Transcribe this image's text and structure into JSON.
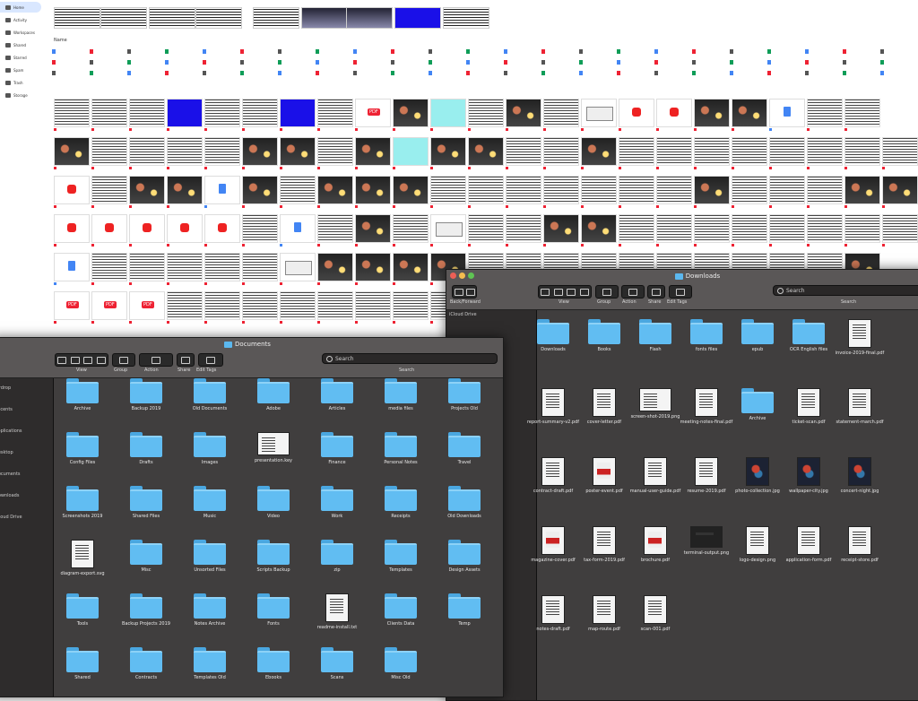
{
  "drive": {
    "sidebar": {
      "items": [
        {
          "label": "Home",
          "icon": "home-icon",
          "active": true
        },
        {
          "label": "Activity",
          "icon": "activity-icon"
        },
        {
          "label": "Workspaces",
          "icon": "workspace-icon"
        },
        {
          "label": "Shared",
          "icon": "shared-icon"
        },
        {
          "label": "Starred",
          "icon": "star-icon"
        },
        {
          "label": "Spam",
          "icon": "spam-icon"
        },
        {
          "label": "Trash",
          "icon": "trash-icon"
        },
        {
          "label": "Storage",
          "icon": "cloud-icon"
        }
      ],
      "storage_text": "",
      "storage_link": ""
    },
    "header": {
      "col_name": "Name",
      "suggested": ""
    },
    "files": []
  },
  "window_right": {
    "title": "Downloads",
    "toolbar": {
      "back_label": "Back/Forward",
      "view_label": "View",
      "group_label": "Group",
      "action_label": "Action",
      "share_label": "Share",
      "tags_label": "Edit Tags",
      "search_placeholder": "Search",
      "search_label": "Search"
    },
    "sidebar": {
      "label": "iCloud Drive"
    },
    "items": [
      {
        "kind": "folder",
        "label": "Downloads"
      },
      {
        "kind": "folder",
        "label": "Books"
      },
      {
        "kind": "folder",
        "label": "Flash"
      },
      {
        "kind": "folder",
        "label": "fonts files"
      },
      {
        "kind": "folder",
        "label": "epub"
      },
      {
        "kind": "folder",
        "label": "OCR English files"
      },
      {
        "kind": "doc",
        "label": "invoice-2019-final.pdf"
      },
      {
        "kind": "doc",
        "label": "report-summary-v2.pdf"
      },
      {
        "kind": "doc",
        "label": "cover-letter.pdf"
      },
      {
        "kind": "wide",
        "label": "screen-shot-2019.png"
      },
      {
        "kind": "doc",
        "label": "meeting-notes-final.pdf"
      },
      {
        "kind": "folder",
        "label": "Archive"
      },
      {
        "kind": "doc",
        "label": "ticket-scan.pdf"
      },
      {
        "kind": "doc",
        "label": "statement-march.pdf"
      },
      {
        "kind": "doc",
        "label": "contract-draft.pdf"
      },
      {
        "kind": "red",
        "label": "poster-event.pdf"
      },
      {
        "kind": "doc",
        "label": "manual-user-guide.pdf"
      },
      {
        "kind": "doc",
        "label": "resume-2019.pdf"
      },
      {
        "kind": "dark",
        "label": "photo-collection.jpg"
      },
      {
        "kind": "dark",
        "label": "wallpaper-city.jpg"
      },
      {
        "kind": "dark",
        "label": "concert-night.jpg"
      },
      {
        "kind": "red",
        "label": "magazine-cover.pdf"
      },
      {
        "kind": "doc",
        "label": "tax-form-2019.pdf"
      },
      {
        "kind": "red",
        "label": "brochure.pdf"
      },
      {
        "kind": "screen",
        "label": "terminal-output.png"
      },
      {
        "kind": "doc",
        "label": "logo-design.png"
      },
      {
        "kind": "doc",
        "label": "application-form.pdf"
      },
      {
        "kind": "doc",
        "label": "receipt-store.pdf"
      },
      {
        "kind": "doc",
        "label": "notes-draft.pdf"
      },
      {
        "kind": "doc",
        "label": "map-route.pdf"
      },
      {
        "kind": "doc",
        "label": "scan-001.pdf"
      }
    ]
  },
  "window_left": {
    "title": "Documents",
    "toolbar": {
      "view_label": "View",
      "group_label": "Group",
      "action_label": "Action",
      "share_label": "Share",
      "tags_label": "Edit Tags",
      "search_placeholder": "Search",
      "search_label": "Search"
    },
    "sidebar": [
      {
        "label": "Airdrop"
      },
      {
        "label": "Recents"
      },
      {
        "label": "Applications"
      },
      {
        "label": "Desktop"
      },
      {
        "label": "Documents"
      },
      {
        "label": "Downloads"
      },
      {
        "label": "iCloud Drive"
      }
    ],
    "items": [
      {
        "kind": "folder",
        "label": "Archive"
      },
      {
        "kind": "folder",
        "label": "Backup 2019"
      },
      {
        "kind": "folder",
        "label": "Old Documents"
      },
      {
        "kind": "folder",
        "label": "Adobe"
      },
      {
        "kind": "folder",
        "label": "Articles"
      },
      {
        "kind": "folder",
        "label": "media files"
      },
      {
        "kind": "folder",
        "label": "Projects Old"
      },
      {
        "kind": "folder",
        "label": "Config Files"
      },
      {
        "kind": "folder",
        "label": "Drafts"
      },
      {
        "kind": "folder",
        "label": "Images"
      },
      {
        "kind": "wide",
        "label": "presentation.key"
      },
      {
        "kind": "folder",
        "label": "Finance"
      },
      {
        "kind": "folder",
        "label": "Personal Notes"
      },
      {
        "kind": "folder",
        "label": "Travel"
      },
      {
        "kind": "folder",
        "label": "Screenshots 2019"
      },
      {
        "kind": "folder",
        "label": "Shared Files"
      },
      {
        "kind": "folder",
        "label": "Music"
      },
      {
        "kind": "folder",
        "label": "Video"
      },
      {
        "kind": "folder",
        "label": "Work"
      },
      {
        "kind": "folder",
        "label": "Receipts"
      },
      {
        "kind": "folder",
        "label": "Old Downloads"
      },
      {
        "kind": "doc",
        "label": "diagram-export.svg"
      },
      {
        "kind": "folder",
        "label": "Misc"
      },
      {
        "kind": "folder",
        "label": "Unsorted Files"
      },
      {
        "kind": "folder",
        "label": "Scripts Backup"
      },
      {
        "kind": "folder",
        "label": "zip"
      },
      {
        "kind": "folder",
        "label": "Templates"
      },
      {
        "kind": "folder",
        "label": "Design Assets"
      },
      {
        "kind": "folder",
        "label": "Tools"
      },
      {
        "kind": "folder",
        "label": "Backup Projects 2019"
      },
      {
        "kind": "folder",
        "label": "Notes Archive"
      },
      {
        "kind": "folder",
        "label": "Fonts"
      },
      {
        "kind": "doc",
        "label": "readme-install.txt"
      },
      {
        "kind": "folder",
        "label": "Clients Data"
      },
      {
        "kind": "folder",
        "label": "Temp"
      },
      {
        "kind": "folder",
        "label": "Shared"
      },
      {
        "kind": "folder",
        "label": "Contracts"
      },
      {
        "kind": "folder",
        "label": "Templates Old"
      },
      {
        "kind": "folder",
        "label": "Ebooks"
      },
      {
        "kind": "folder",
        "label": "Scans"
      },
      {
        "kind": "folder",
        "label": "Misc Old"
      }
    ]
  },
  "colors": {
    "folder": "#61bdf2",
    "finder_bg": "#403e3e",
    "drive_active": "#d9e7ff"
  }
}
